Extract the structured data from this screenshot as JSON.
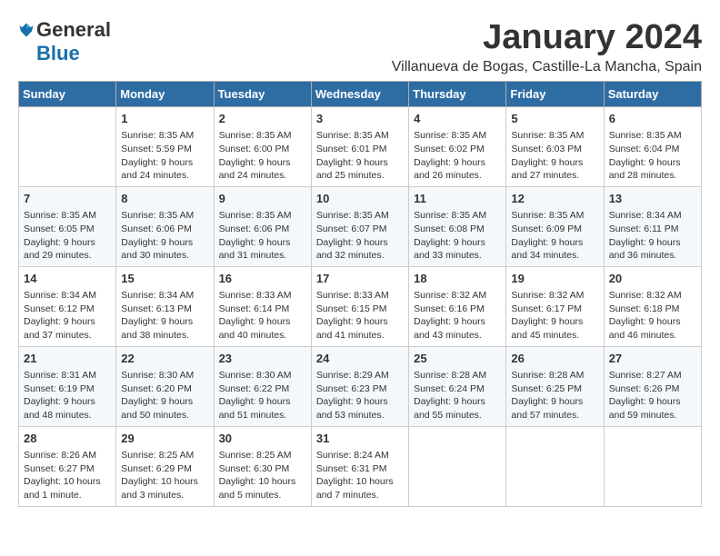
{
  "logo": {
    "general": "General",
    "blue": "Blue"
  },
  "title": "January 2024",
  "location": "Villanueva de Bogas, Castille-La Mancha, Spain",
  "weekdays": [
    "Sunday",
    "Monday",
    "Tuesday",
    "Wednesday",
    "Thursday",
    "Friday",
    "Saturday"
  ],
  "weeks": [
    [
      {
        "day": "",
        "sunrise": "",
        "sunset": "",
        "daylight": ""
      },
      {
        "day": "1",
        "sunrise": "Sunrise: 8:35 AM",
        "sunset": "Sunset: 5:59 PM",
        "daylight": "Daylight: 9 hours and 24 minutes."
      },
      {
        "day": "2",
        "sunrise": "Sunrise: 8:35 AM",
        "sunset": "Sunset: 6:00 PM",
        "daylight": "Daylight: 9 hours and 24 minutes."
      },
      {
        "day": "3",
        "sunrise": "Sunrise: 8:35 AM",
        "sunset": "Sunset: 6:01 PM",
        "daylight": "Daylight: 9 hours and 25 minutes."
      },
      {
        "day": "4",
        "sunrise": "Sunrise: 8:35 AM",
        "sunset": "Sunset: 6:02 PM",
        "daylight": "Daylight: 9 hours and 26 minutes."
      },
      {
        "day": "5",
        "sunrise": "Sunrise: 8:35 AM",
        "sunset": "Sunset: 6:03 PM",
        "daylight": "Daylight: 9 hours and 27 minutes."
      },
      {
        "day": "6",
        "sunrise": "Sunrise: 8:35 AM",
        "sunset": "Sunset: 6:04 PM",
        "daylight": "Daylight: 9 hours and 28 minutes."
      }
    ],
    [
      {
        "day": "7",
        "sunrise": "Sunrise: 8:35 AM",
        "sunset": "Sunset: 6:05 PM",
        "daylight": "Daylight: 9 hours and 29 minutes."
      },
      {
        "day": "8",
        "sunrise": "Sunrise: 8:35 AM",
        "sunset": "Sunset: 6:06 PM",
        "daylight": "Daylight: 9 hours and 30 minutes."
      },
      {
        "day": "9",
        "sunrise": "Sunrise: 8:35 AM",
        "sunset": "Sunset: 6:06 PM",
        "daylight": "Daylight: 9 hours and 31 minutes."
      },
      {
        "day": "10",
        "sunrise": "Sunrise: 8:35 AM",
        "sunset": "Sunset: 6:07 PM",
        "daylight": "Daylight: 9 hours and 32 minutes."
      },
      {
        "day": "11",
        "sunrise": "Sunrise: 8:35 AM",
        "sunset": "Sunset: 6:08 PM",
        "daylight": "Daylight: 9 hours and 33 minutes."
      },
      {
        "day": "12",
        "sunrise": "Sunrise: 8:35 AM",
        "sunset": "Sunset: 6:09 PM",
        "daylight": "Daylight: 9 hours and 34 minutes."
      },
      {
        "day": "13",
        "sunrise": "Sunrise: 8:34 AM",
        "sunset": "Sunset: 6:11 PM",
        "daylight": "Daylight: 9 hours and 36 minutes."
      }
    ],
    [
      {
        "day": "14",
        "sunrise": "Sunrise: 8:34 AM",
        "sunset": "Sunset: 6:12 PM",
        "daylight": "Daylight: 9 hours and 37 minutes."
      },
      {
        "day": "15",
        "sunrise": "Sunrise: 8:34 AM",
        "sunset": "Sunset: 6:13 PM",
        "daylight": "Daylight: 9 hours and 38 minutes."
      },
      {
        "day": "16",
        "sunrise": "Sunrise: 8:33 AM",
        "sunset": "Sunset: 6:14 PM",
        "daylight": "Daylight: 9 hours and 40 minutes."
      },
      {
        "day": "17",
        "sunrise": "Sunrise: 8:33 AM",
        "sunset": "Sunset: 6:15 PM",
        "daylight": "Daylight: 9 hours and 41 minutes."
      },
      {
        "day": "18",
        "sunrise": "Sunrise: 8:32 AM",
        "sunset": "Sunset: 6:16 PM",
        "daylight": "Daylight: 9 hours and 43 minutes."
      },
      {
        "day": "19",
        "sunrise": "Sunrise: 8:32 AM",
        "sunset": "Sunset: 6:17 PM",
        "daylight": "Daylight: 9 hours and 45 minutes."
      },
      {
        "day": "20",
        "sunrise": "Sunrise: 8:32 AM",
        "sunset": "Sunset: 6:18 PM",
        "daylight": "Daylight: 9 hours and 46 minutes."
      }
    ],
    [
      {
        "day": "21",
        "sunrise": "Sunrise: 8:31 AM",
        "sunset": "Sunset: 6:19 PM",
        "daylight": "Daylight: 9 hours and 48 minutes."
      },
      {
        "day": "22",
        "sunrise": "Sunrise: 8:30 AM",
        "sunset": "Sunset: 6:20 PM",
        "daylight": "Daylight: 9 hours and 50 minutes."
      },
      {
        "day": "23",
        "sunrise": "Sunrise: 8:30 AM",
        "sunset": "Sunset: 6:22 PM",
        "daylight": "Daylight: 9 hours and 51 minutes."
      },
      {
        "day": "24",
        "sunrise": "Sunrise: 8:29 AM",
        "sunset": "Sunset: 6:23 PM",
        "daylight": "Daylight: 9 hours and 53 minutes."
      },
      {
        "day": "25",
        "sunrise": "Sunrise: 8:28 AM",
        "sunset": "Sunset: 6:24 PM",
        "daylight": "Daylight: 9 hours and 55 minutes."
      },
      {
        "day": "26",
        "sunrise": "Sunrise: 8:28 AM",
        "sunset": "Sunset: 6:25 PM",
        "daylight": "Daylight: 9 hours and 57 minutes."
      },
      {
        "day": "27",
        "sunrise": "Sunrise: 8:27 AM",
        "sunset": "Sunset: 6:26 PM",
        "daylight": "Daylight: 9 hours and 59 minutes."
      }
    ],
    [
      {
        "day": "28",
        "sunrise": "Sunrise: 8:26 AM",
        "sunset": "Sunset: 6:27 PM",
        "daylight": "Daylight: 10 hours and 1 minute."
      },
      {
        "day": "29",
        "sunrise": "Sunrise: 8:25 AM",
        "sunset": "Sunset: 6:29 PM",
        "daylight": "Daylight: 10 hours and 3 minutes."
      },
      {
        "day": "30",
        "sunrise": "Sunrise: 8:25 AM",
        "sunset": "Sunset: 6:30 PM",
        "daylight": "Daylight: 10 hours and 5 minutes."
      },
      {
        "day": "31",
        "sunrise": "Sunrise: 8:24 AM",
        "sunset": "Sunset: 6:31 PM",
        "daylight": "Daylight: 10 hours and 7 minutes."
      },
      {
        "day": "",
        "sunrise": "",
        "sunset": "",
        "daylight": ""
      },
      {
        "day": "",
        "sunrise": "",
        "sunset": "",
        "daylight": ""
      },
      {
        "day": "",
        "sunrise": "",
        "sunset": "",
        "daylight": ""
      }
    ]
  ]
}
